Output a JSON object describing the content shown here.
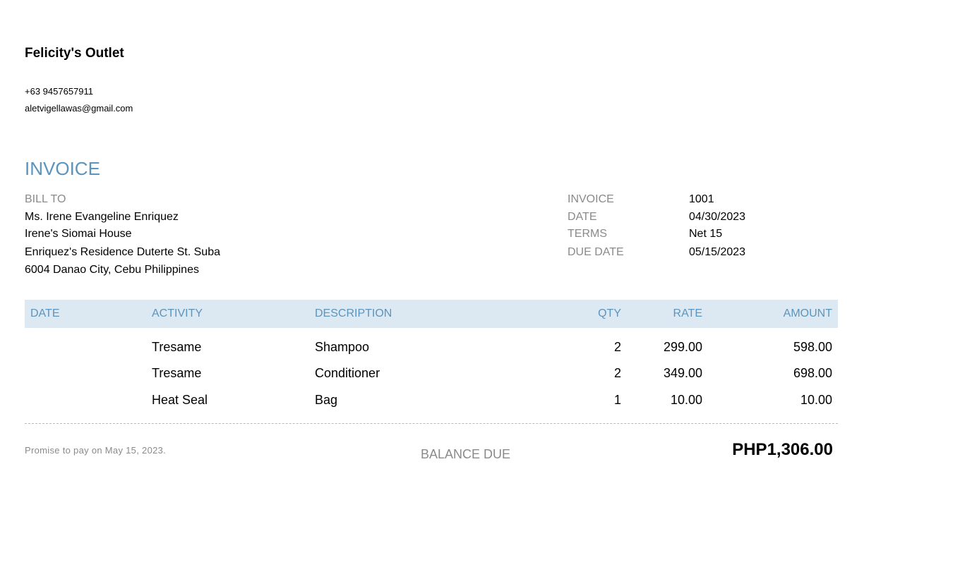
{
  "company": {
    "name": "Felicity's Outlet",
    "phone": "+63 9457657911",
    "email": "aletvigellawas@gmail.com"
  },
  "invoice_title": "INVOICE",
  "bill_to": {
    "label": "BILL TO",
    "lines": [
      "Ms. Irene Evangeline Enriquez",
      "Irene's Siomai House",
      "Enriquez's Residence Duterte St. Suba",
      "6004 Danao City, Cebu Philippines"
    ]
  },
  "meta": [
    {
      "label": "INVOICE",
      "value": "1001"
    },
    {
      "label": "DATE",
      "value": "04/30/2023"
    },
    {
      "label": "TERMS",
      "value": "Net 15"
    },
    {
      "label": "DUE DATE",
      "value": "05/15/2023"
    }
  ],
  "table": {
    "headers": {
      "date": "DATE",
      "activity": "ACTIVITY",
      "description": "DESCRIPTION",
      "qty": "QTY",
      "rate": "RATE",
      "amount": "AMOUNT"
    },
    "rows": [
      {
        "date": "",
        "activity": "Tresame",
        "description": "Shampoo",
        "qty": "2",
        "rate": "299.00",
        "amount": "598.00"
      },
      {
        "date": "",
        "activity": "Tresame",
        "description": "Conditioner",
        "qty": "2",
        "rate": "349.00",
        "amount": "698.00"
      },
      {
        "date": "",
        "activity": "Heat Seal",
        "description": "Bag",
        "qty": "1",
        "rate": "10.00",
        "amount": "10.00"
      }
    ]
  },
  "footer": {
    "note": "Promise to pay on May 15, 2023.",
    "balance_label": "BALANCE DUE",
    "balance_value": "PHP1,306.00"
  }
}
